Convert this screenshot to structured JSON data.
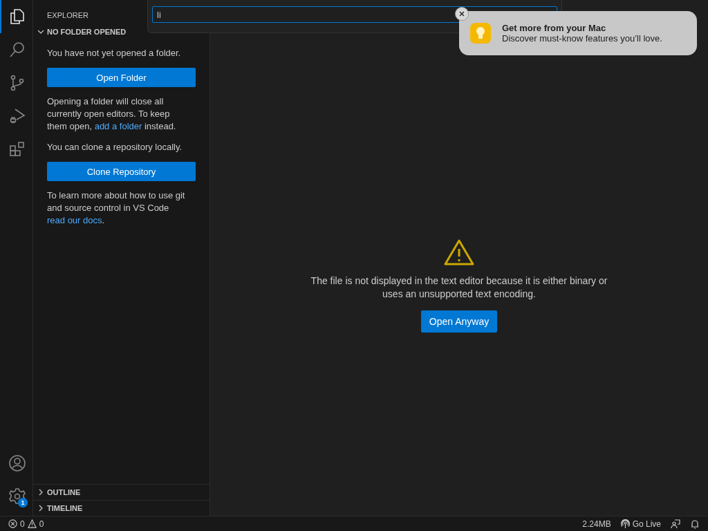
{
  "activity_bar": {
    "items": [
      {
        "kind": "files",
        "selected": true
      },
      {
        "kind": "search",
        "selected": false
      },
      {
        "kind": "source-control",
        "selected": false
      },
      {
        "kind": "run-debug",
        "selected": false
      },
      {
        "kind": "extensions",
        "selected": false
      }
    ],
    "bottom_items": [
      {
        "kind": "account"
      },
      {
        "kind": "settings",
        "badge": "1"
      }
    ]
  },
  "sidebar": {
    "title": "EXPLORER",
    "section": {
      "title": "NO FOLDER OPENED",
      "expanded": true
    },
    "blocks": [
      {
        "kind": "text",
        "before": "You have not yet opened a folder."
      },
      {
        "kind": "button",
        "label": "Open Folder"
      },
      {
        "kind": "text",
        "before": "Opening a folder will close all currently open editors. To keep them open, ",
        "link": "add a folder",
        "after": " instead."
      },
      {
        "kind": "text",
        "before": "You can clone a repository locally."
      },
      {
        "kind": "button",
        "label": "Clone Repository"
      },
      {
        "kind": "text",
        "before": "To learn more about how to use git and source control in VS Code ",
        "link": "read our docs",
        "after": "."
      }
    ],
    "panels": [
      {
        "title": "OUTLINE",
        "expanded": false
      },
      {
        "title": "TIMELINE",
        "expanded": false
      }
    ]
  },
  "quick_input": {
    "value": "li"
  },
  "editor": {
    "message": "The file is not displayed in the text editor because it is either binary or uses an unsupported text encoding.",
    "button": "Open Anyway"
  },
  "notification": {
    "title": "Get more from your Mac",
    "body": "Discover must-know features you’ll love."
  },
  "status_bar": {
    "errors": "0",
    "warnings": "0",
    "size": "2.24MB",
    "go_live": "Go Live"
  }
}
